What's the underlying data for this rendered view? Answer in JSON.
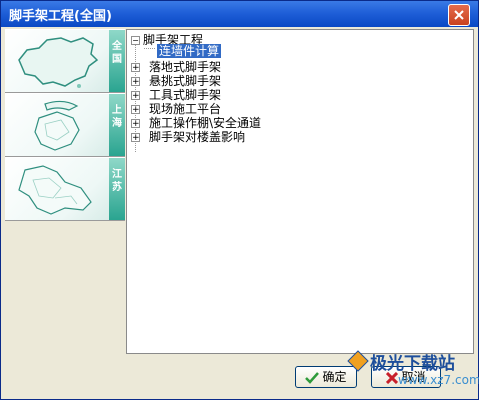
{
  "window": {
    "title": "脚手架工程(全国)"
  },
  "regions": [
    {
      "label": "全国",
      "icon": "china-map-icon"
    },
    {
      "label": "上海",
      "icon": "shanghai-map-icon"
    },
    {
      "label": "江苏",
      "icon": "jiangsu-map-icon"
    }
  ],
  "tree": {
    "root": "脚手架工程",
    "root_expander": "⊟",
    "selected_child": "连墙件计算",
    "items": [
      {
        "label": "落地式脚手架",
        "expander": "+"
      },
      {
        "label": "悬挑式脚手架",
        "expander": "+"
      },
      {
        "label": "工具式脚手架",
        "expander": "+"
      },
      {
        "label": "现场施工平台",
        "expander": "+"
      },
      {
        "label": "施工操作棚\\安全通道",
        "expander": "+"
      },
      {
        "label": "脚手架对楼盖影响",
        "expander": "+"
      }
    ]
  },
  "buttons": {
    "ok": "确定",
    "cancel": "取消"
  },
  "watermark": {
    "title": "极光下载站",
    "url": "www.xz7.com"
  },
  "colors": {
    "titlebar": "#1f5fd8",
    "selection": "#316ac5",
    "tab_accent": "#2aa490"
  }
}
